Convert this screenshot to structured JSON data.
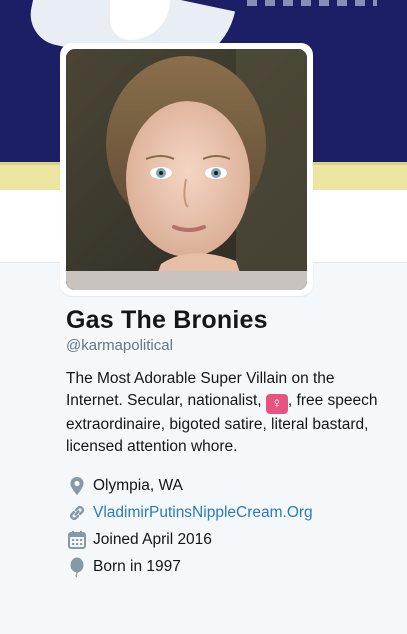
{
  "profile": {
    "display_name": "Gas The Bronies",
    "handle": "@karmapolitical",
    "bio": {
      "part1": "The Most Adorable Super Villain on the Internet. Secular, nationalist, ",
      "emoji": "♀",
      "part2": ", free speech extraordinaire, bigoted satire, literal bastard, licensed attention whore."
    },
    "location": "Olympia, WA",
    "website": "VladimirPutinsNippleCream.Org",
    "joined": "Joined April 2016",
    "born": "Born in 1997"
  },
  "icons": {
    "location": "map-pin-icon",
    "website": "link-icon",
    "joined": "calendar-icon",
    "born": "balloon-icon"
  },
  "colors": {
    "banner": "#1c1f66",
    "link": "#2b7bb9",
    "muted": "#657786",
    "text": "#14171a",
    "emoji_bg": "#e75480"
  }
}
